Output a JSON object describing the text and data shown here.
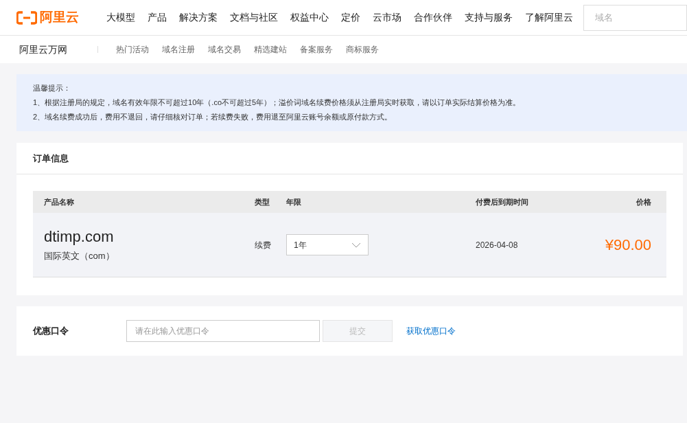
{
  "header": {
    "logo_text": "阿里云",
    "nav": [
      "大模型",
      "产品",
      "解决方案",
      "文档与社区",
      "权益中心",
      "定价",
      "云市场",
      "合作伙伴",
      "支持与服务",
      "了解阿里云"
    ],
    "search": {
      "placeholder": "域名"
    }
  },
  "subnav": {
    "title": "阿里云万网",
    "items": [
      "热门活动",
      "域名注册",
      "域名交易",
      "精选建站",
      "备案服务",
      "商标服务"
    ]
  },
  "notice": {
    "title": "温馨提示：",
    "lines": [
      "1、根据注册局的规定，域名有效年限不可超过10年（.co不可超过5年）；溢价词域名续费价格须从注册局实时获取，请以订单实际结算价格为准。",
      "2、域名续费成功后，费用不退回，请仔细核对订单；若续费失败，费用退至阿里云账号余额或原付款方式。"
    ]
  },
  "order": {
    "title": "订单信息",
    "columns": [
      "产品名称",
      "类型",
      "年限",
      "付费后到期时间",
      "价格"
    ],
    "rows": [
      {
        "domain": "dtimp.com",
        "suffix": "国际英文（com）",
        "type": "续费",
        "years": "1年",
        "expiry": "2026-04-08",
        "price": "¥90.00"
      }
    ]
  },
  "coupon": {
    "label": "优惠口令",
    "placeholder": "请在此输入优惠口令",
    "submit": {
      "label": "提交",
      "disabled": true
    },
    "link": "获取优惠口令"
  }
}
